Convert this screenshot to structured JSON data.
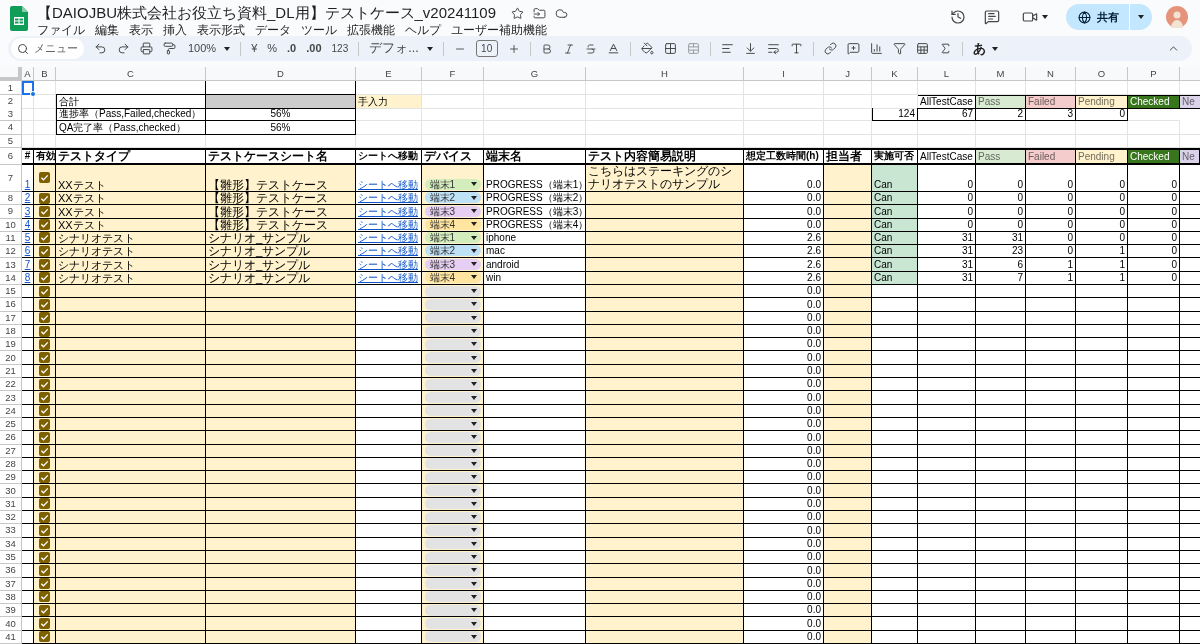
{
  "document": {
    "title": "【DAIOJBU株式会社お役立ち資料_DL用】テストケース_v20241109"
  },
  "menu": [
    "ファイル",
    "編集",
    "表示",
    "挿入",
    "表示形式",
    "データ",
    "ツール",
    "拡張機能",
    "ヘルプ",
    "ユーザー補助機能"
  ],
  "toolbar": {
    "search_placeholder": "メニュー",
    "zoom": "100%",
    "currency": "¥",
    "percent": "%",
    "decrease_decimal": ".0",
    "increase_decimal": ".00",
    "number_format": "123",
    "font": "デフォ...",
    "font_size": "10",
    "input_tool": "あ"
  },
  "share_button": {
    "label": "共有"
  },
  "sheet": {
    "columns": [
      "A",
      "B",
      "C",
      "D",
      "E",
      "F",
      "G",
      "H",
      "I",
      "J",
      "K",
      "L",
      "M",
      "N",
      "O",
      "P"
    ],
    "top_row_labels": [
      "1",
      "2",
      "3",
      "4",
      "5",
      "6"
    ],
    "summary": {
      "total_label": "合計",
      "progress_label": "進捗率（Pass,Failed,checked）",
      "progress_value": "56%",
      "qa_label": "QA完了率（Pass,checked）",
      "qa_value": "56%",
      "manual_input_label": "手入力"
    },
    "status_headers": [
      {
        "label": "AllTestCase",
        "color": "#ffffff"
      },
      {
        "label": "Pass",
        "color": "#d9ead3"
      },
      {
        "label": "Failed",
        "color": "#f4cccc"
      },
      {
        "label": "Pending",
        "color": "#fff2cc"
      },
      {
        "label": "Checked",
        "color": "#38761d"
      },
      {
        "label": "Ne",
        "color": "#d9d2e9"
      }
    ],
    "status_totals": [
      "124",
      "67",
      "2",
      "3",
      "0"
    ],
    "table_headers": [
      "#",
      "有効",
      "テストタイプ",
      "テストケースシート名",
      "シートへ移動",
      "デバイス",
      "端末名",
      "テスト内容簡易説明",
      "想定工数時間(h)",
      "担当者",
      "実施可否"
    ],
    "table_status_headers": [
      {
        "label": "AllTestCase",
        "color": "#ffffff"
      },
      {
        "label": "Pass",
        "color": "#d9ead3"
      },
      {
        "label": "Failed",
        "color": "#f4cccc"
      },
      {
        "label": "Pending",
        "color": "#fff2cc"
      },
      {
        "label": "Checked",
        "color": "#38761d"
      },
      {
        "label": "Ne",
        "color": "#d9d2e9"
      }
    ],
    "rows": [
      {
        "row_label": "7",
        "number": "1",
        "checked": true,
        "test_type": "XXテスト",
        "sheet_name": "【雛形】テストケース",
        "link": "シートへ移動",
        "device": {
          "label": "端末1",
          "color": "#d4edbc"
        },
        "terminal": "PROGRESS（端末1）",
        "description": "こちらはステーキングのシナリオテストのサンプル",
        "hours": "0.0",
        "availability": "Can",
        "counts": [
          "0",
          "0",
          "0",
          "0",
          "0"
        ]
      },
      {
        "row_label": "8",
        "number": "2",
        "checked": true,
        "test_type": "XXテスト",
        "sheet_name": "【雛形】テストケース",
        "link": "シートへ移動",
        "device": {
          "label": "端末2",
          "color": "#bfe1f6"
        },
        "terminal": "PROGRESS（端末2）",
        "hours": "0.0",
        "availability": "Can",
        "counts": [
          "0",
          "0",
          "0",
          "0",
          "0"
        ]
      },
      {
        "row_label": "9",
        "number": "3",
        "checked": true,
        "test_type": "XXテスト",
        "sheet_name": "【雛形】テストケース",
        "link": "シートへ移動",
        "device": {
          "label": "端末3",
          "color": "#e6cff2"
        },
        "terminal": "PROGRESS（端末3）",
        "hours": "0.0",
        "availability": "Can",
        "counts": [
          "0",
          "0",
          "0",
          "0",
          "0"
        ]
      },
      {
        "row_label": "10",
        "number": "4",
        "checked": true,
        "test_type": "XXテスト",
        "sheet_name": "【雛形】テストケース",
        "link": "シートへ移動",
        "device": {
          "label": "端末4",
          "color": "#ffe5a0"
        },
        "terminal": "PROGRESS（端末4）",
        "hours": "0.0",
        "availability": "Can",
        "counts": [
          "0",
          "0",
          "0",
          "0",
          "0"
        ]
      },
      {
        "row_label": "11",
        "number": "5",
        "checked": true,
        "test_type": "シナリオテスト",
        "sheet_name": "シナリオ_サンプル",
        "link": "シートへ移動",
        "device": {
          "label": "端末1",
          "color": "#d4edbc"
        },
        "terminal": "iphone",
        "hours": "2.6",
        "availability": "Can",
        "counts": [
          "31",
          "31",
          "0",
          "0",
          "0"
        ]
      },
      {
        "row_label": "12",
        "number": "6",
        "checked": true,
        "test_type": "シナリオテスト",
        "sheet_name": "シナリオ_サンプル",
        "link": "シートへ移動",
        "device": {
          "label": "端末2",
          "color": "#bfe1f6"
        },
        "terminal": "mac",
        "hours": "2.6",
        "availability": "Can",
        "counts": [
          "31",
          "23",
          "0",
          "1",
          "0"
        ]
      },
      {
        "row_label": "13",
        "number": "7",
        "checked": true,
        "test_type": "シナリオテスト",
        "sheet_name": "シナリオ_サンプル",
        "link": "シートへ移動",
        "device": {
          "label": "端末3",
          "color": "#e6cff2"
        },
        "terminal": "android",
        "hours": "2.6",
        "availability": "Can",
        "counts": [
          "31",
          "6",
          "1",
          "1",
          "0"
        ]
      },
      {
        "row_label": "14",
        "number": "8",
        "checked": true,
        "test_type": "シナリオテスト",
        "sheet_name": "シナリオ_サンプル",
        "link": "シートへ移動",
        "device": {
          "label": "端末4",
          "color": "#ffe5a0"
        },
        "terminal": "win",
        "hours": "2.6",
        "availability": "Can",
        "counts": [
          "31",
          "7",
          "1",
          "1",
          "0"
        ]
      }
    ],
    "empty_rows": [
      {
        "row_label": "15",
        "checked": true,
        "hours": "0.0"
      },
      {
        "row_label": "16",
        "checked": true,
        "hours": "0.0"
      },
      {
        "row_label": "17",
        "checked": true,
        "hours": "0.0"
      },
      {
        "row_label": "18",
        "checked": true,
        "hours": "0.0"
      },
      {
        "row_label": "19",
        "checked": true,
        "hours": "0.0"
      },
      {
        "row_label": "20",
        "checked": true,
        "hours": "0.0"
      },
      {
        "row_label": "21",
        "checked": true,
        "hours": "0.0"
      },
      {
        "row_label": "22",
        "checked": true,
        "hours": "0.0"
      },
      {
        "row_label": "23",
        "checked": true,
        "hours": "0.0"
      },
      {
        "row_label": "24",
        "checked": true,
        "hours": "0.0"
      },
      {
        "row_label": "25",
        "checked": true,
        "hours": "0.0"
      },
      {
        "row_label": "26",
        "checked": true,
        "hours": "0.0"
      },
      {
        "row_label": "27",
        "checked": true,
        "hours": "0.0"
      },
      {
        "row_label": "28",
        "checked": true,
        "hours": "0.0"
      },
      {
        "row_label": "29",
        "checked": true,
        "hours": "0.0"
      },
      {
        "row_label": "30",
        "checked": true,
        "hours": "0.0"
      },
      {
        "row_label": "31",
        "checked": true,
        "hours": "0.0"
      },
      {
        "row_label": "32",
        "checked": true,
        "hours": "0.0"
      },
      {
        "row_label": "33",
        "checked": true,
        "hours": "0.0"
      },
      {
        "row_label": "34",
        "checked": true,
        "hours": "0.0"
      },
      {
        "row_label": "35",
        "checked": true,
        "hours": "0.0"
      },
      {
        "row_label": "36",
        "checked": true,
        "hours": "0.0"
      },
      {
        "row_label": "37",
        "checked": true,
        "hours": "0.0"
      },
      {
        "row_label": "38",
        "checked": true,
        "hours": "0.0"
      },
      {
        "row_label": "39",
        "checked": true,
        "hours": "0.0"
      },
      {
        "row_label": "40",
        "checked": true,
        "hours": "0.0"
      },
      {
        "row_label": "41",
        "checked": true,
        "hours": "0.0"
      }
    ]
  }
}
